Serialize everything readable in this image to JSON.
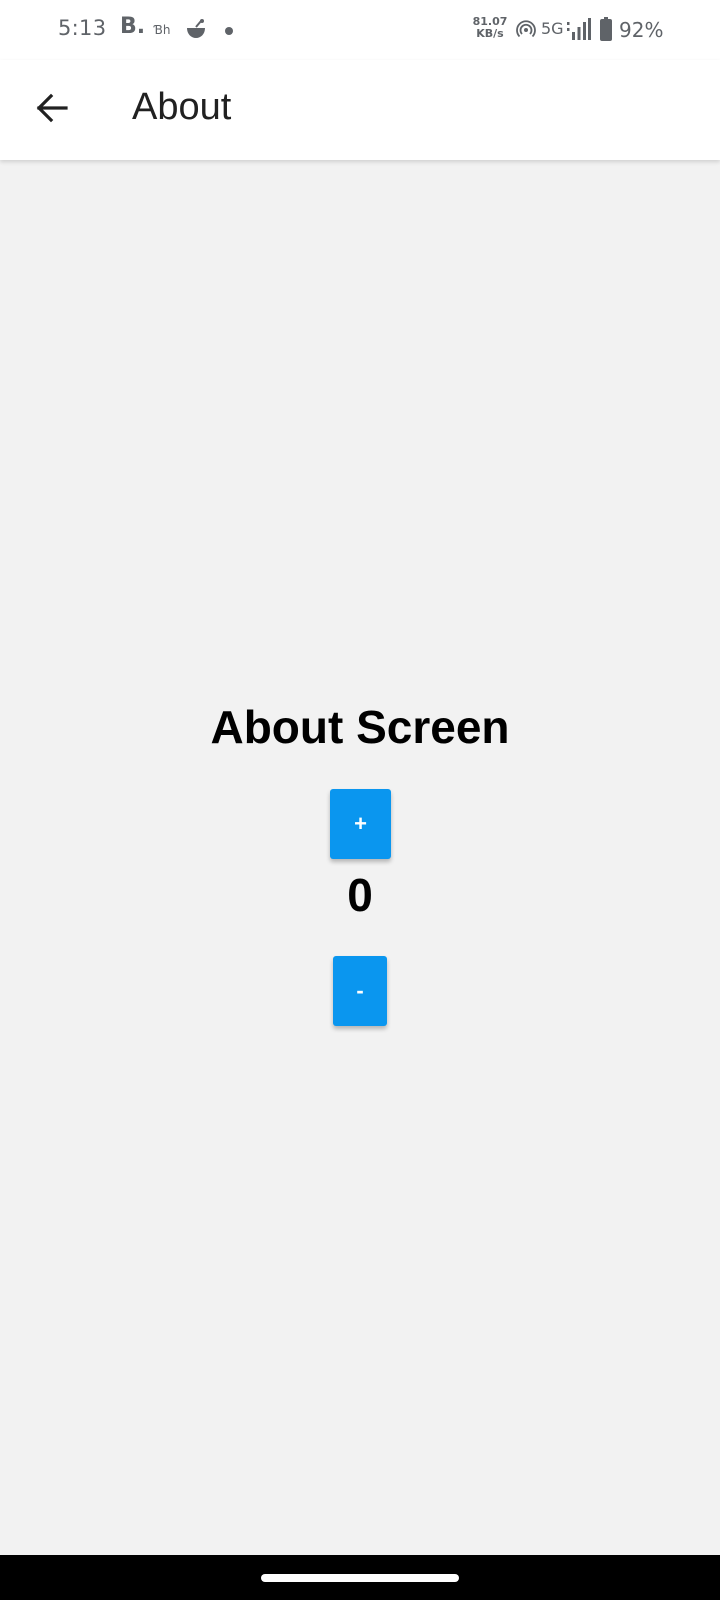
{
  "status_bar": {
    "time": "5:13",
    "notif_b": "B.",
    "notif_bh": "Ɓh",
    "net_speed_value": "81.07",
    "net_speed_unit": "KB/s",
    "network_type": "5G",
    "battery": "92%",
    "icons": [
      "bowl-icon",
      "dot-icon",
      "hotspot-icon",
      "signal-icon",
      "battery-icon"
    ]
  },
  "app_bar": {
    "title": "About",
    "back_icon": "arrow-left-icon"
  },
  "main": {
    "heading": "About Screen",
    "increment_label": "+",
    "counter": "0",
    "decrement_label": "-"
  },
  "colors": {
    "accent": "#0a96ef",
    "background": "#f2f2f2",
    "app_bar": "#ffffff",
    "nav_bar": "#000000"
  }
}
